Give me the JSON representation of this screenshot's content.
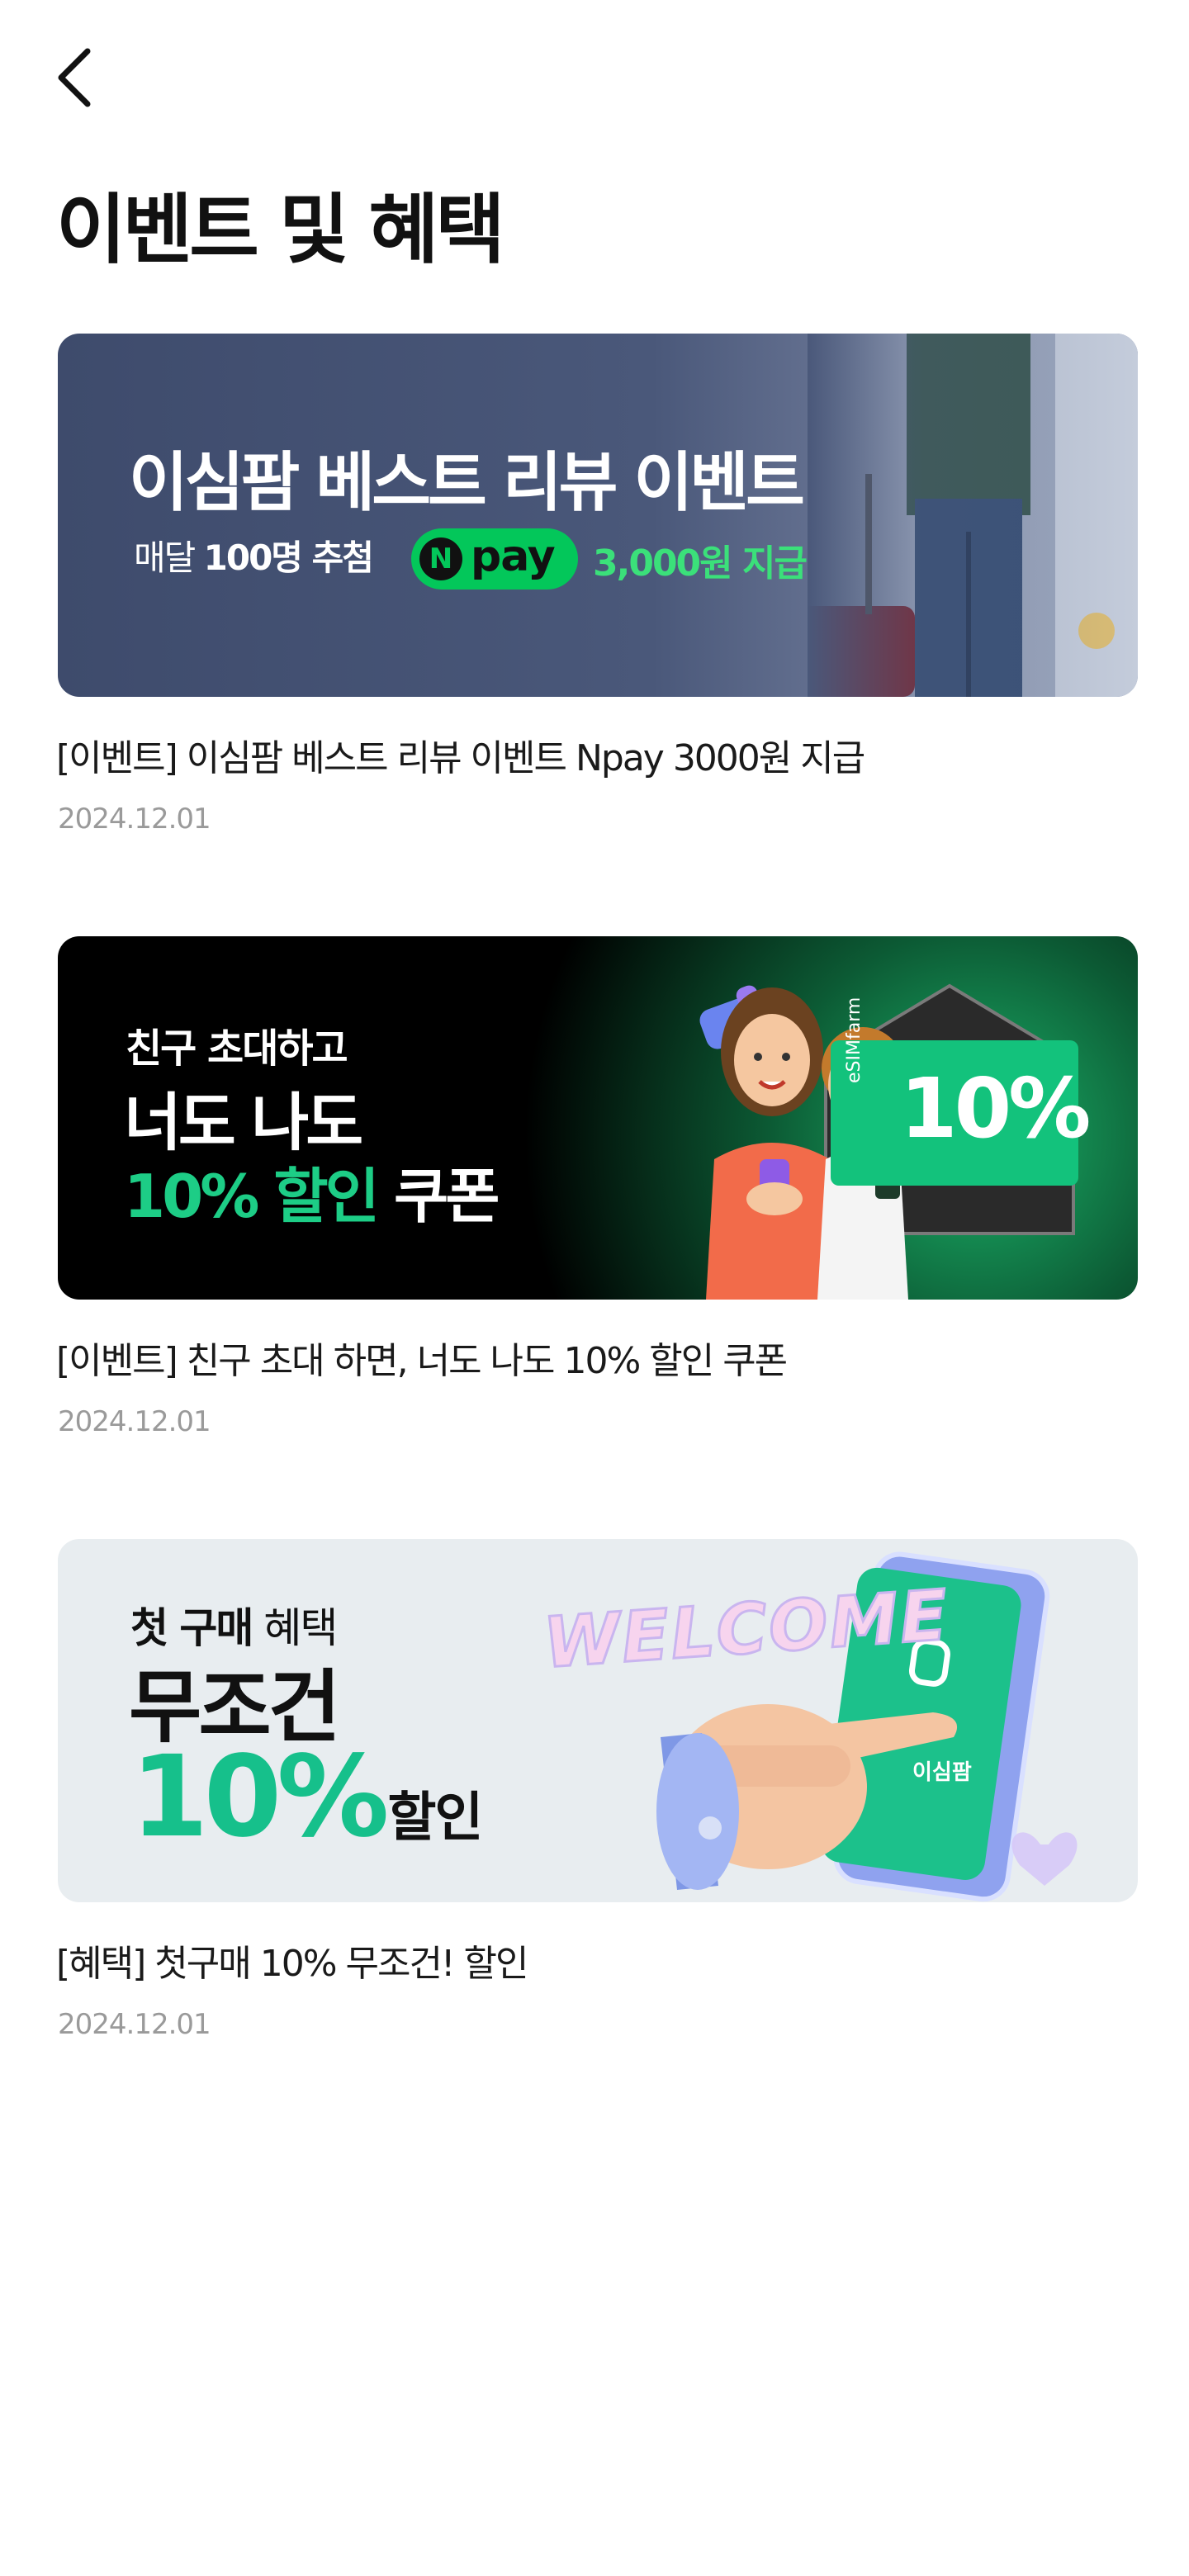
{
  "header": {
    "title": "이벤트 및 혜택"
  },
  "posts": [
    {
      "banner": {
        "headline": "이심팜 베스트 리뷰 이벤트",
        "sub_prefix": "매달",
        "sub_bold": "100명 추첨",
        "badge_n": "N",
        "badge_text": "pay",
        "amount": "3,000원 지급"
      },
      "title": "[이벤트] 이심팜 베스트 리뷰 이벤트 Npay 3000원 지급",
      "date": "2024.12.01"
    },
    {
      "banner": {
        "line1": "친구 초대하고",
        "line2": "너도 나도",
        "line3_green": "10% 할인",
        "line3_white": "쿠폰",
        "coupon_brand": "eSIMfarm",
        "coupon_value": "10%"
      },
      "title": "[이벤트] 친구 초대 하면, 너도 나도 10% 할인 쿠폰",
      "date": "2024.12.01"
    },
    {
      "banner": {
        "line1_bold": "첫 구매",
        "line1_rest": "혜택",
        "line2": "무조건",
        "line3_big": "10%",
        "line3_small": "할인",
        "welcome": "WELCOME",
        "phone_brand": "이심팜"
      },
      "title": "[혜택] 첫구매 10% 무조건! 할인",
      "date": "2024.12.01"
    }
  ],
  "colors": {
    "accent_green": "#1dcd86",
    "npay_green": "#03c75a",
    "date_gray": "#9a9a9a",
    "banner1_bg": "#3e4b6c"
  },
  "icons": {
    "back": "chevron-left-icon"
  }
}
